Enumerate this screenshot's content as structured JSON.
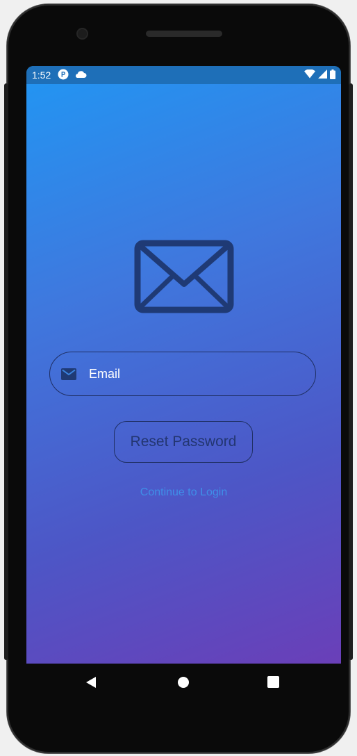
{
  "status_bar": {
    "time": "1:52",
    "left_icons": [
      "notification-badge-icon",
      "cloud-icon"
    ],
    "right_icons": [
      "wifi-icon",
      "cell-signal-icon",
      "battery-icon"
    ],
    "background": "#1e6fb8"
  },
  "screen": {
    "gradient_start": "#2196f3",
    "gradient_end": "#6a3fb8",
    "hero_icon": "envelope-icon"
  },
  "email_field": {
    "icon": "mail-icon",
    "placeholder": "Email",
    "value": ""
  },
  "reset_button": {
    "label": "Reset Password"
  },
  "login_link": {
    "label": "Continue to Login"
  },
  "nav_bar": {
    "buttons": [
      "back-icon",
      "home-icon",
      "recents-icon"
    ]
  },
  "colors": {
    "outline": "#1f2f63",
    "link": "#3f8fe8",
    "button_text": "#233671"
  }
}
